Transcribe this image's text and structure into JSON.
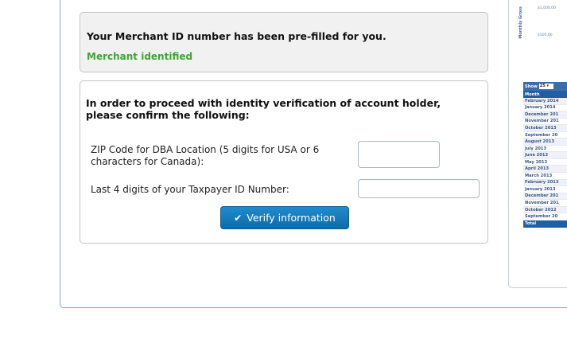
{
  "merchant": {
    "title": "Your Merchant ID number has been pre-filled for you.",
    "status": "Merchant identified",
    "status_color": "#3fa535"
  },
  "verify": {
    "heading": "In order to proceed with identity verification of account holder, please confirm the following:",
    "zip_label": "ZIP Code for DBA Location (5 digits for USA or 6 characters for Canada):",
    "zip_value": "",
    "taxid_label": "Last 4 digits of your Taxpayer ID Number:",
    "taxid_value": "",
    "button_label": "Verify information",
    "button_icon": "check-icon",
    "accent_color": "#1b7fc2"
  },
  "side_panel": {
    "chart_ylabel": "Monthly Gross",
    "ticks": [
      "$1,000,00",
      "$500,00"
    ],
    "show_label": "Show",
    "show_value": "25 ▾",
    "table_header": "Month",
    "months": [
      "February 2014",
      "January 2014",
      "December 201",
      "November 201",
      "October 2013",
      "September 20",
      "August 2013",
      "July 2013",
      "June 2013",
      "May 2013",
      "April 2013",
      "March 2013",
      "February 2013",
      "January 2013",
      "December 201",
      "November 201",
      "October 2012",
      "September 20"
    ],
    "total_label": "Total"
  }
}
